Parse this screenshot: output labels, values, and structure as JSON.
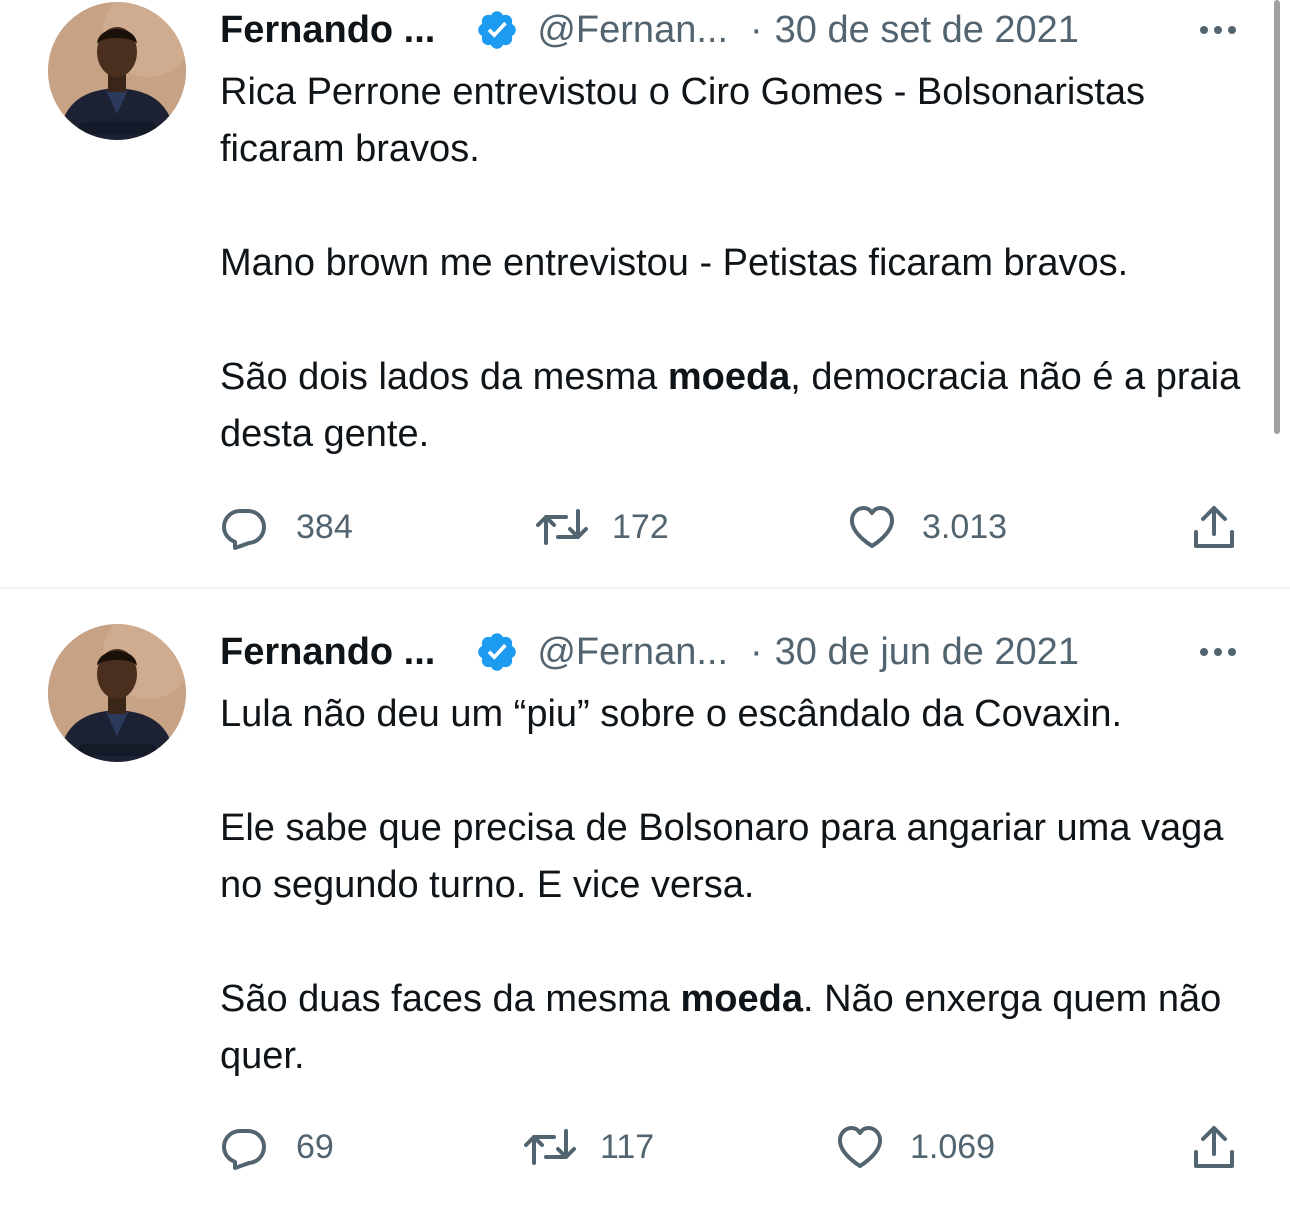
{
  "tweets": [
    {
      "author": {
        "name": "Fernando ...",
        "handle": "@Fernan...",
        "verified": true
      },
      "separator": "·",
      "date": "30 de set de 2021",
      "paragraphs": [
        [
          {
            "text": "Rica Perrone entrevistou o Ciro Gomes - Bolsonaristas ficaram bravos."
          }
        ],
        [
          {
            "text": "Mano brown me entrevistou - Petistas ficaram bravos."
          }
        ],
        [
          {
            "text": "São dois lados da mesma "
          },
          {
            "text": "moeda",
            "bold": true
          },
          {
            "text": ", democracia não é a praia desta gente."
          }
        ]
      ],
      "stats": {
        "replies": "384",
        "retweets": "172",
        "likes": "3.013"
      }
    },
    {
      "author": {
        "name": "Fernando ...",
        "handle": "@Fernan...",
        "verified": true
      },
      "separator": "·",
      "date": "30 de jun de 2021",
      "paragraphs": [
        [
          {
            "text": "Lula não deu um “piu” sobre o escândalo da Covaxin."
          }
        ],
        [
          {
            "text": "Ele sabe que precisa de Bolsonaro para angariar uma vaga no segundo turno. E vice versa."
          }
        ],
        [
          {
            "text": "São duas faces da mesma "
          },
          {
            "text": "moeda",
            "bold": true
          },
          {
            "text": ". Não enxerga quem não quer."
          }
        ]
      ],
      "stats": {
        "replies": "69",
        "retweets": "117",
        "likes": "1.069"
      }
    }
  ],
  "icons": {
    "verified": "verified-badge-icon",
    "more": "more-dots-icon",
    "reply": "reply-bubble-icon",
    "retweet": "retweet-icon",
    "like": "heart-icon",
    "share": "share-upload-icon"
  },
  "colors": {
    "text": "#0f1419",
    "secondary": "#536471",
    "verified": "#1d9bf0",
    "divider": "#eff3f4"
  }
}
